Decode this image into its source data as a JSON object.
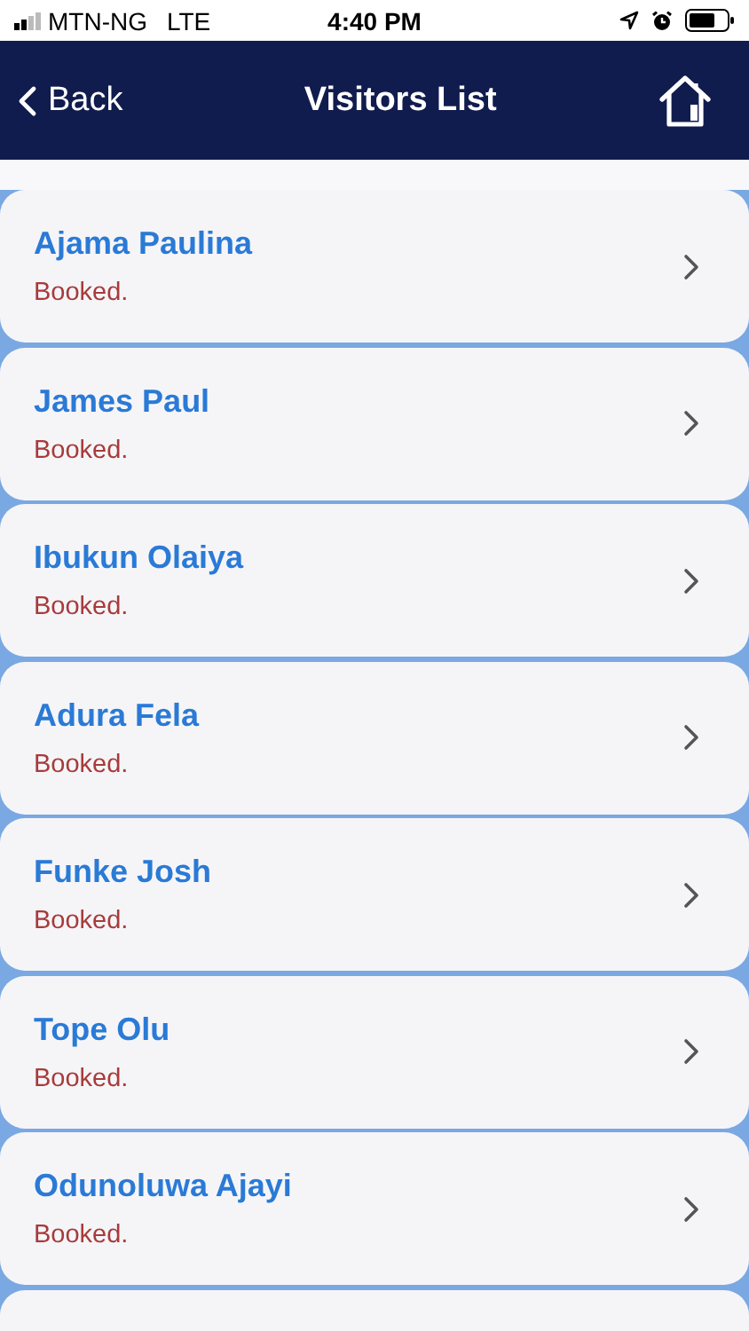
{
  "status_bar": {
    "carrier": "MTN-NG",
    "network": "LTE",
    "time": "4:40 PM"
  },
  "header": {
    "back": "Back",
    "title": "Visitors List"
  },
  "visitors": [
    {
      "name": "Ajama Paulina",
      "status": "Booked."
    },
    {
      "name": "James Paul",
      "status": "Booked."
    },
    {
      "name": "Ibukun Olaiya",
      "status": "Booked."
    },
    {
      "name": "Adura Fela",
      "status": "Booked."
    },
    {
      "name": "Funke Josh",
      "status": "Booked."
    },
    {
      "name": "Tope Olu",
      "status": "Booked."
    },
    {
      "name": "Odunoluwa Ajayi",
      "status": "Booked."
    }
  ]
}
